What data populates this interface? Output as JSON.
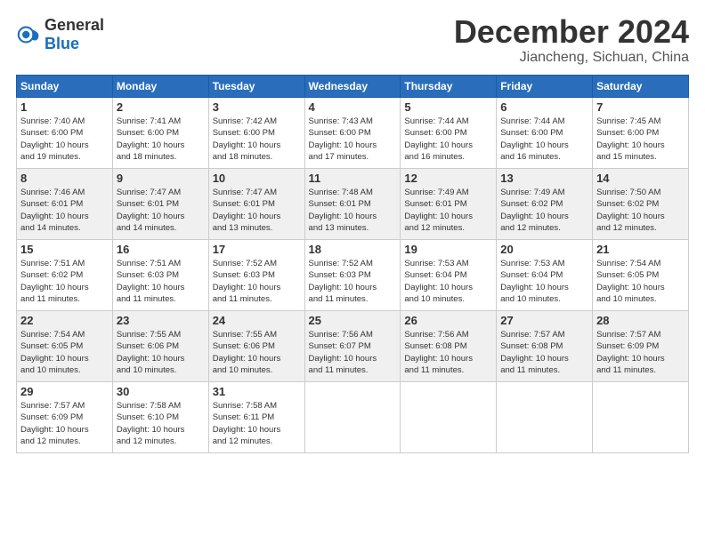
{
  "logo": {
    "text_general": "General",
    "text_blue": "Blue"
  },
  "title": "December 2024",
  "location": "Jiancheng, Sichuan, China",
  "days_of_week": [
    "Sunday",
    "Monday",
    "Tuesday",
    "Wednesday",
    "Thursday",
    "Friday",
    "Saturday"
  ],
  "weeks": [
    [
      {
        "day": "1",
        "sunrise": "7:40 AM",
        "sunset": "6:00 PM",
        "daylight": "10 hours and 19 minutes."
      },
      {
        "day": "2",
        "sunrise": "7:41 AM",
        "sunset": "6:00 PM",
        "daylight": "10 hours and 18 minutes."
      },
      {
        "day": "3",
        "sunrise": "7:42 AM",
        "sunset": "6:00 PM",
        "daylight": "10 hours and 18 minutes."
      },
      {
        "day": "4",
        "sunrise": "7:43 AM",
        "sunset": "6:00 PM",
        "daylight": "10 hours and 17 minutes."
      },
      {
        "day": "5",
        "sunrise": "7:44 AM",
        "sunset": "6:00 PM",
        "daylight": "10 hours and 16 minutes."
      },
      {
        "day": "6",
        "sunrise": "7:44 AM",
        "sunset": "6:00 PM",
        "daylight": "10 hours and 16 minutes."
      },
      {
        "day": "7",
        "sunrise": "7:45 AM",
        "sunset": "6:00 PM",
        "daylight": "10 hours and 15 minutes."
      }
    ],
    [
      {
        "day": "8",
        "sunrise": "7:46 AM",
        "sunset": "6:01 PM",
        "daylight": "10 hours and 14 minutes."
      },
      {
        "day": "9",
        "sunrise": "7:47 AM",
        "sunset": "6:01 PM",
        "daylight": "10 hours and 14 minutes."
      },
      {
        "day": "10",
        "sunrise": "7:47 AM",
        "sunset": "6:01 PM",
        "daylight": "10 hours and 13 minutes."
      },
      {
        "day": "11",
        "sunrise": "7:48 AM",
        "sunset": "6:01 PM",
        "daylight": "10 hours and 13 minutes."
      },
      {
        "day": "12",
        "sunrise": "7:49 AM",
        "sunset": "6:01 PM",
        "daylight": "10 hours and 12 minutes."
      },
      {
        "day": "13",
        "sunrise": "7:49 AM",
        "sunset": "6:02 PM",
        "daylight": "10 hours and 12 minutes."
      },
      {
        "day": "14",
        "sunrise": "7:50 AM",
        "sunset": "6:02 PM",
        "daylight": "10 hours and 12 minutes."
      }
    ],
    [
      {
        "day": "15",
        "sunrise": "7:51 AM",
        "sunset": "6:02 PM",
        "daylight": "10 hours and 11 minutes."
      },
      {
        "day": "16",
        "sunrise": "7:51 AM",
        "sunset": "6:03 PM",
        "daylight": "10 hours and 11 minutes."
      },
      {
        "day": "17",
        "sunrise": "7:52 AM",
        "sunset": "6:03 PM",
        "daylight": "10 hours and 11 minutes."
      },
      {
        "day": "18",
        "sunrise": "7:52 AM",
        "sunset": "6:03 PM",
        "daylight": "10 hours and 11 minutes."
      },
      {
        "day": "19",
        "sunrise": "7:53 AM",
        "sunset": "6:04 PM",
        "daylight": "10 hours and 10 minutes."
      },
      {
        "day": "20",
        "sunrise": "7:53 AM",
        "sunset": "6:04 PM",
        "daylight": "10 hours and 10 minutes."
      },
      {
        "day": "21",
        "sunrise": "7:54 AM",
        "sunset": "6:05 PM",
        "daylight": "10 hours and 10 minutes."
      }
    ],
    [
      {
        "day": "22",
        "sunrise": "7:54 AM",
        "sunset": "6:05 PM",
        "daylight": "10 hours and 10 minutes."
      },
      {
        "day": "23",
        "sunrise": "7:55 AM",
        "sunset": "6:06 PM",
        "daylight": "10 hours and 10 minutes."
      },
      {
        "day": "24",
        "sunrise": "7:55 AM",
        "sunset": "6:06 PM",
        "daylight": "10 hours and 10 minutes."
      },
      {
        "day": "25",
        "sunrise": "7:56 AM",
        "sunset": "6:07 PM",
        "daylight": "10 hours and 11 minutes."
      },
      {
        "day": "26",
        "sunrise": "7:56 AM",
        "sunset": "6:08 PM",
        "daylight": "10 hours and 11 minutes."
      },
      {
        "day": "27",
        "sunrise": "7:57 AM",
        "sunset": "6:08 PM",
        "daylight": "10 hours and 11 minutes."
      },
      {
        "day": "28",
        "sunrise": "7:57 AM",
        "sunset": "6:09 PM",
        "daylight": "10 hours and 11 minutes."
      }
    ],
    [
      {
        "day": "29",
        "sunrise": "7:57 AM",
        "sunset": "6:09 PM",
        "daylight": "10 hours and 12 minutes."
      },
      {
        "day": "30",
        "sunrise": "7:58 AM",
        "sunset": "6:10 PM",
        "daylight": "10 hours and 12 minutes."
      },
      {
        "day": "31",
        "sunrise": "7:58 AM",
        "sunset": "6:11 PM",
        "daylight": "10 hours and 12 minutes."
      },
      null,
      null,
      null,
      null
    ]
  ]
}
